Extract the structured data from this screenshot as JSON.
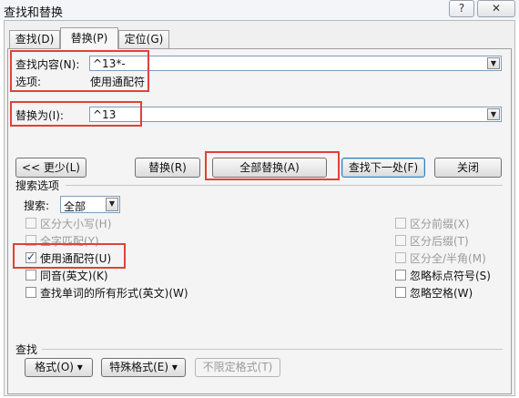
{
  "window": {
    "title": "查找和替换",
    "help_label": "?",
    "close_label": "✕"
  },
  "tabs": [
    {
      "label": "查找(D)"
    },
    {
      "label": "替换(P)"
    },
    {
      "label": "定位(G)"
    }
  ],
  "find": {
    "label": "查找内容(N):",
    "value": "^13*-",
    "options_label": "选项:",
    "options_value": "使用通配符"
  },
  "replace": {
    "label": "替换为(I):",
    "value": "^13"
  },
  "buttons": {
    "less": "<< 更少(L)",
    "replace": "替换(R)",
    "replace_all": "全部替换(A)",
    "find_next": "查找下一处(F)",
    "close": "关闭"
  },
  "search_options": {
    "section_label": "搜索选项",
    "search_label": "搜索:",
    "search_value": "全部",
    "left_checkboxes": [
      {
        "label": "区分大小写(H)",
        "checked": false,
        "disabled": true
      },
      {
        "label": "全字匹配(Y)",
        "checked": false,
        "disabled": true
      },
      {
        "label": "使用通配符(U)",
        "checked": true,
        "disabled": false
      },
      {
        "label": "同音(英文)(K)",
        "checked": false,
        "disabled": false
      },
      {
        "label": "查找单词的所有形式(英文)(W)",
        "checked": false,
        "disabled": false
      }
    ],
    "right_checkboxes": [
      {
        "label": "区分前缀(X)",
        "checked": false,
        "disabled": true
      },
      {
        "label": "区分后缀(T)",
        "checked": false,
        "disabled": true
      },
      {
        "label": "区分全/半角(M)",
        "checked": false,
        "disabled": true
      },
      {
        "label": "忽略标点符号(S)",
        "checked": false,
        "disabled": false
      },
      {
        "label": "忽略空格(W)",
        "checked": false,
        "disabled": false
      }
    ]
  },
  "bottom": {
    "section_label": "查找",
    "format_button": "格式(O) ▾",
    "special_button": "特殊格式(E) ▾",
    "no_format_button": "不限定格式(T)"
  },
  "colors": {
    "highlight": "#e0413b",
    "accent": "#3c7fb1"
  }
}
